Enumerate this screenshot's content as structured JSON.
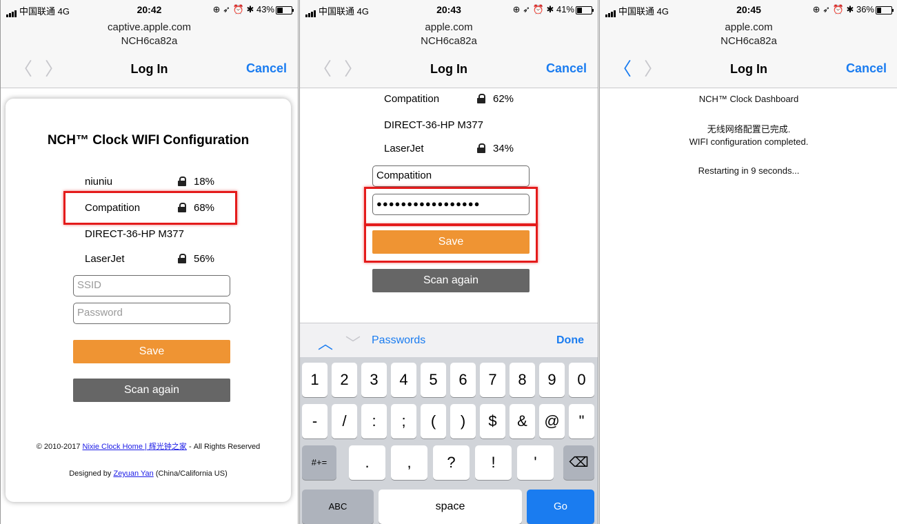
{
  "screens": [
    {
      "status": {
        "carrier": "中国联通 4G",
        "time": "20:42",
        "battery": "43%",
        "battery_level": 0.43,
        "icons": [
          "location-lock-icon",
          "location-arrow-icon",
          "alarm-icon",
          "bluetooth-icon"
        ]
      },
      "url_line1": "captive.apple.com",
      "url_line2": "NCH6ca82a",
      "nav": {
        "title": "Log In",
        "cancel": "Cancel",
        "back_enabled": false
      },
      "card": {
        "title": "NCH™ Clock WIFI Configuration",
        "networks": [
          {
            "name": "niuniu",
            "locked": true,
            "signal": "18%"
          },
          {
            "name": "Compatition",
            "locked": true,
            "signal": "68%",
            "highlighted": true
          },
          {
            "name": "DIRECT-36-HP M377",
            "locked": false,
            "signal": ""
          },
          {
            "name": "LaserJet",
            "locked": true,
            "signal": "56%"
          }
        ],
        "ssid_placeholder": "SSID",
        "password_placeholder": "Password",
        "save": "Save",
        "scan": "Scan again",
        "footer1_prefix": "© 2010-2017 ",
        "footer1_link": "Nixie Clock Home | 辉光钟之家",
        "footer1_suffix": " - All Rights Reserved",
        "footer2_prefix": "Designed by ",
        "footer2_link": "Zeyuan Yan",
        "footer2_suffix": " (China/California US)"
      }
    },
    {
      "status": {
        "carrier": "中国联通 4G",
        "time": "20:43",
        "battery": "41%",
        "battery_level": 0.41
      },
      "url_line1": "apple.com",
      "url_line2": "NCH6ca82a",
      "nav": {
        "title": "Log In",
        "cancel": "Cancel",
        "back_enabled": false
      },
      "networks": [
        {
          "name": "Compatition",
          "locked": true,
          "signal": "62%"
        },
        {
          "name": "DIRECT-36-HP M377",
          "locked": false,
          "signal": ""
        },
        {
          "name": "LaserJet",
          "locked": true,
          "signal": "34%"
        }
      ],
      "ssid_value": "Compatition",
      "password_value": "●●●●●●●●●●●●●●●●●",
      "save": "Save",
      "scan": "Scan again",
      "keyboard": {
        "passwords": "Passwords",
        "done": "Done",
        "row1": [
          "1",
          "2",
          "3",
          "4",
          "5",
          "6",
          "7",
          "8",
          "9",
          "0"
        ],
        "row2": [
          "-",
          "/",
          ":",
          ";",
          "(",
          ")",
          "$",
          "&",
          "@",
          "\""
        ],
        "row3": [
          ".",
          ",",
          "?",
          "!",
          "'"
        ],
        "symbols": "#+=",
        "abc": "ABC",
        "space": "space",
        "go": "Go"
      }
    },
    {
      "status": {
        "carrier": "中国联通 4G",
        "time": "20:45",
        "battery": "36%",
        "battery_level": 0.36
      },
      "url_line1": "apple.com",
      "url_line2": "NCH6ca82a",
      "nav": {
        "title": "Log In",
        "cancel": "Cancel",
        "back_enabled": true
      },
      "dashboard_title": "NCH™ Clock Dashboard",
      "done_cn": "无线网络配置已完成.",
      "done_en": "WIFI configuration completed.",
      "restart": "Restarting in 9 seconds..."
    }
  ],
  "colors": {
    "accent": "#1a7cf0",
    "save": "#ef9433",
    "scan": "#666666",
    "highlight": "#e41b1b"
  }
}
